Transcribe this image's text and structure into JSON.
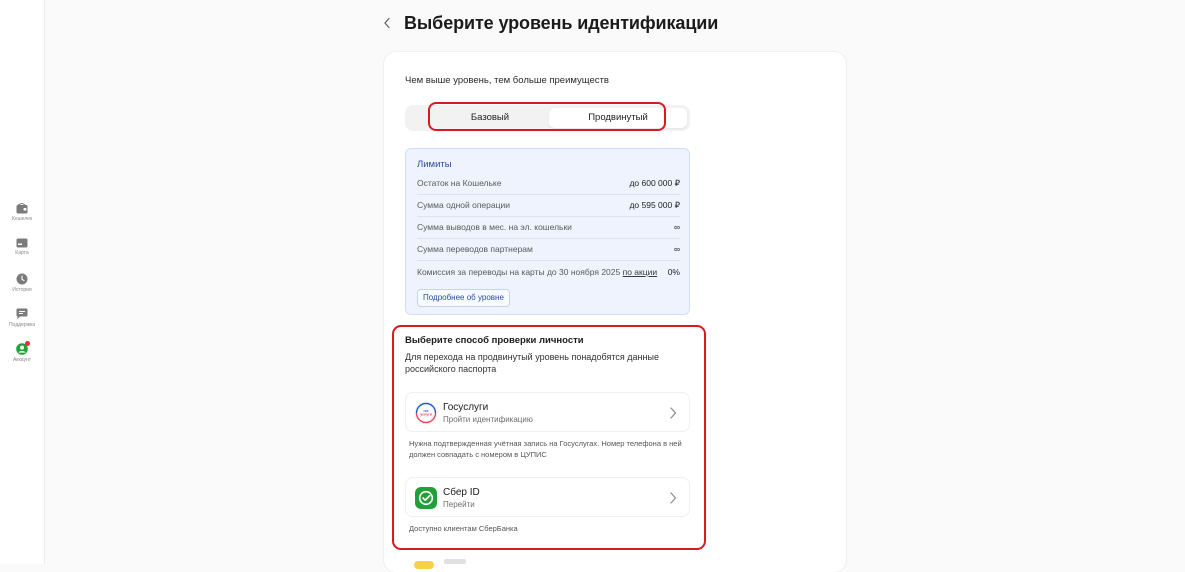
{
  "sidebar": {
    "items": [
      {
        "label": "Кошелек",
        "icon": "wallet-icon"
      },
      {
        "label": "Карта",
        "icon": "card-icon"
      },
      {
        "label": "История",
        "icon": "clock-icon"
      },
      {
        "label": "Поддержка",
        "icon": "chat-icon"
      },
      {
        "label": "Аккаунт",
        "icon": "account-icon",
        "active": true
      }
    ]
  },
  "header": {
    "back_icon": "chevron-left-icon",
    "title": "Выберите уровень идентификации"
  },
  "main": {
    "subtitle": "Чем выше уровень, тем больше преимуществ",
    "segments": [
      {
        "label": "Базовый",
        "selected": false
      },
      {
        "label": "Продвинутый",
        "selected": true
      }
    ],
    "limits": {
      "title": "Лимиты",
      "rows": [
        {
          "label": "Остаток на Кошельке",
          "value": "до 600 000 ₽"
        },
        {
          "label": "Сумма одной операции",
          "value": "до 595 000 ₽"
        },
        {
          "label": "Сумма выводов в мес. на эл. кошельки",
          "value": "∞"
        },
        {
          "label": "Сумма переводов партнерам",
          "value": "∞"
        },
        {
          "label": "Комиссия за переводы на карты до 30 ноября 2025",
          "link": "по акции",
          "value": "0%"
        }
      ],
      "more_button": "Подробнее об уровне"
    },
    "verification": {
      "title": "Выберите способ проверки личности",
      "description": "Для перехода на продвинутый уровень понадобятся данные российского паспорта",
      "methods": [
        {
          "name": "Госуслуги",
          "subtitle": "Пройти идентификацию",
          "logo_text": "гос услуги",
          "icon": "gosuslugi-logo",
          "note": "Нужна подтвержденная учётная запись на Госуслугах. Номер телефона в ней должен совпадать с номером в ЦУПИС"
        },
        {
          "name": "Сбер ID",
          "subtitle": "Перейти",
          "icon": "sber-id-logo",
          "note": "Доступно клиентам СберБанка"
        }
      ]
    }
  },
  "colors": {
    "highlight": "#d81b22",
    "active_nav": "#21a038",
    "limits_bg": "#eef3fd",
    "limits_title": "#2b4f9a",
    "sber_green": "#21a038"
  }
}
